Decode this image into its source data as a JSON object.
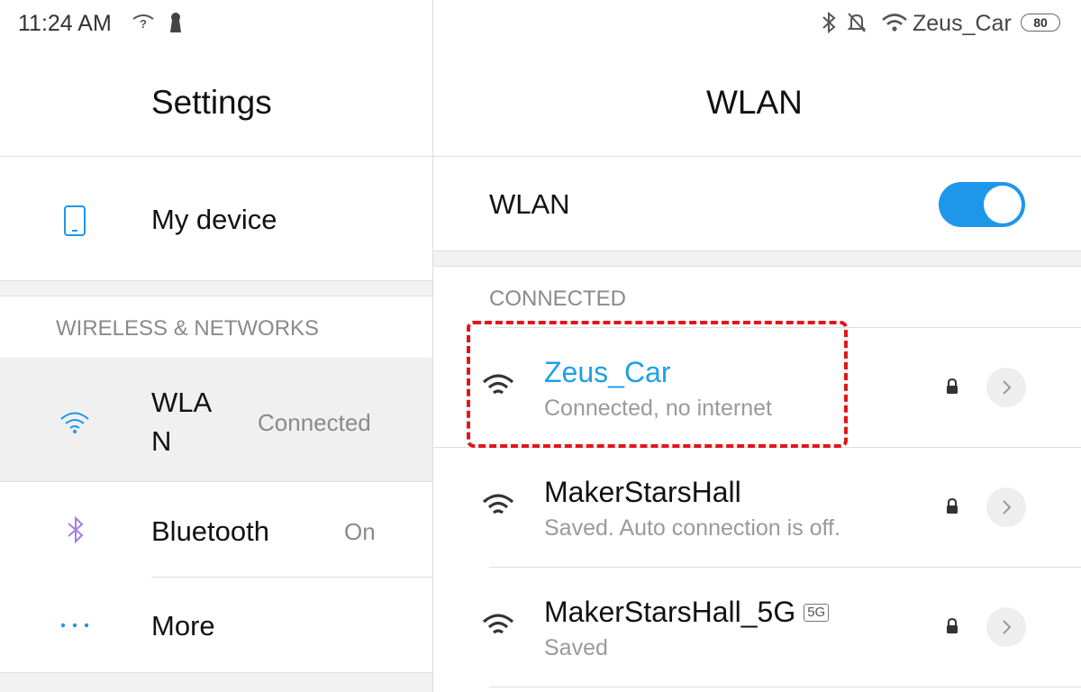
{
  "status_bar": {
    "time": "11:24  AM",
    "network_name": "Zeus_Car",
    "battery": "80"
  },
  "left_pane": {
    "title": "Settings",
    "my_device_label": "My device",
    "section_wireless": "WIRELESS & NETWORKS",
    "wlan_label_line1": "WLA",
    "wlan_label_line2": "N",
    "wlan_status": "Connected",
    "bluetooth_label": "Bluetooth",
    "bluetooth_status": "On",
    "more_label": "More"
  },
  "right_pane": {
    "title": "WLAN",
    "wlan_toggle_label": "WLAN",
    "wlan_toggle_on": true,
    "section_connected": "CONNECTED",
    "networks": [
      {
        "name": "Zeus_Car",
        "status": "Connected, no internet"
      },
      {
        "name": "MakerStarsHall",
        "status": "Saved. Auto connection is off."
      },
      {
        "name": "MakerStarsHall_5G",
        "badge": "5G",
        "status": "Saved"
      }
    ]
  },
  "colors": {
    "accent": "#1e96ea",
    "connected_text": "#1ea0e6",
    "highlight": "#e3151a"
  }
}
